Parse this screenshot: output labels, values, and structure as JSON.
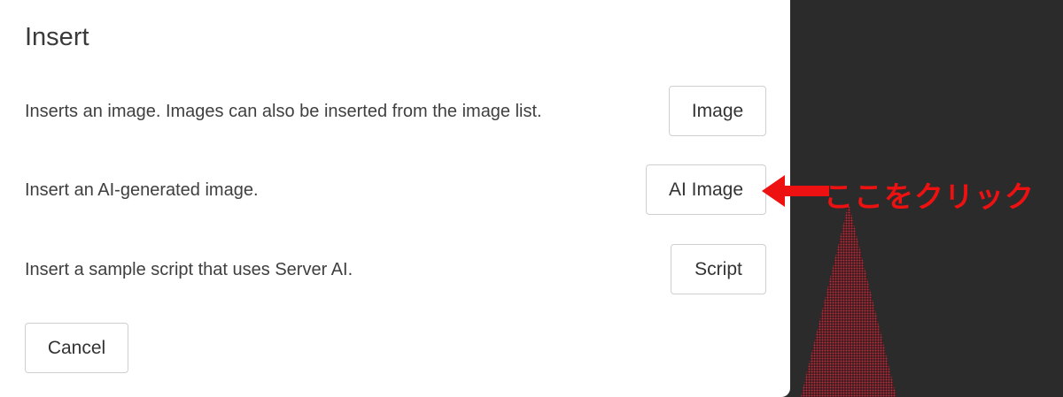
{
  "dialog": {
    "title": "Insert",
    "rows": [
      {
        "description": "Inserts an image. Images can also be inserted from the image list.",
        "button_label": "Image"
      },
      {
        "description": "Insert an AI-generated image.",
        "button_label": "AI Image"
      },
      {
        "description": "Insert a sample script that uses Server AI.",
        "button_label": "Script"
      }
    ],
    "cancel_label": "Cancel"
  },
  "annotation": {
    "text": "ここをクリック",
    "color": "#ee1111",
    "icon": "arrow-left-icon"
  },
  "colors": {
    "backdrop": "#2b2b2b",
    "dialog_background": "#ffffff",
    "button_border": "#cfcfcf"
  }
}
